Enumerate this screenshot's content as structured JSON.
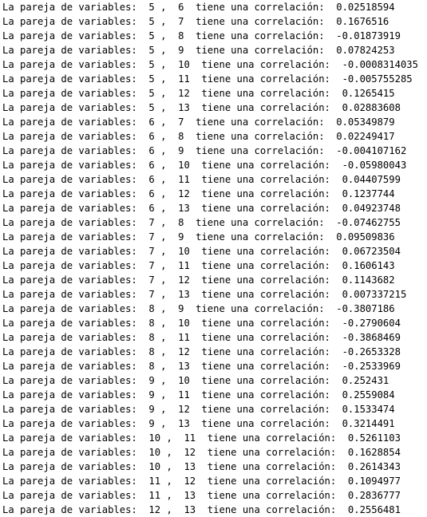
{
  "console": {
    "lines": [
      "La pareja de variables:  5 ,  6  tiene una correlación:  0.02518594",
      "La pareja de variables:  5 ,  7  tiene una correlación:  0.1676516",
      "La pareja de variables:  5 ,  8  tiene una correlación:  -0.01873919",
      "La pareja de variables:  5 ,  9  tiene una correlación:  0.07824253",
      "La pareja de variables:  5 ,  10  tiene una correlación:  -0.0008314035",
      "La pareja de variables:  5 ,  11  tiene una correlación:  -0.005755285",
      "La pareja de variables:  5 ,  12  tiene una correlación:  0.1265415",
      "La pareja de variables:  5 ,  13  tiene una correlación:  0.02883608",
      "La pareja de variables:  6 ,  7  tiene una correlación:  0.05349879",
      "La pareja de variables:  6 ,  8  tiene una correlación:  0.02249417",
      "La pareja de variables:  6 ,  9  tiene una correlación:  -0.004107162",
      "La pareja de variables:  6 ,  10  tiene una correlación:  -0.05980043",
      "La pareja de variables:  6 ,  11  tiene una correlación:  0.04407599",
      "La pareja de variables:  6 ,  12  tiene una correlación:  0.1237744",
      "La pareja de variables:  6 ,  13  tiene una correlación:  0.04923748",
      "La pareja de variables:  7 ,  8  tiene una correlación:  -0.07462755",
      "La pareja de variables:  7 ,  9  tiene una correlación:  0.09509836",
      "La pareja de variables:  7 ,  10  tiene una correlación:  0.06723504",
      "La pareja de variables:  7 ,  11  tiene una correlación:  0.1606143",
      "La pareja de variables:  7 ,  12  tiene una correlación:  0.1143682",
      "La pareja de variables:  7 ,  13  tiene una correlación:  0.007337215",
      "La pareja de variables:  8 ,  9  tiene una correlación:  -0.3807186",
      "La pareja de variables:  8 ,  10  tiene una correlación:  -0.2790604",
      "La pareja de variables:  8 ,  11  tiene una correlación:  -0.3868469",
      "La pareja de variables:  8 ,  12  tiene una correlación:  -0.2653328",
      "La pareja de variables:  8 ,  13  tiene una correlación:  -0.2533969",
      "La pareja de variables:  9 ,  10  tiene una correlación:  0.252431",
      "La pareja de variables:  9 ,  11  tiene una correlación:  0.2559084",
      "La pareja de variables:  9 ,  12  tiene una correlación:  0.1533474",
      "La pareja de variables:  9 ,  13  tiene una correlación:  0.3214491",
      "La pareja de variables:  10 ,  11  tiene una correlación:  0.5261103",
      "La pareja de variables:  10 ,  12  tiene una correlación:  0.1628854",
      "La pareja de variables:  10 ,  13  tiene una correlación:  0.2614343",
      "La pareja de variables:  11 ,  12  tiene una correlación:  0.1094977",
      "La pareja de variables:  11 ,  13  tiene una correlación:  0.2836777",
      "La pareja de variables:  12 ,  13  tiene una correlación:  0.2556481"
    ]
  }
}
